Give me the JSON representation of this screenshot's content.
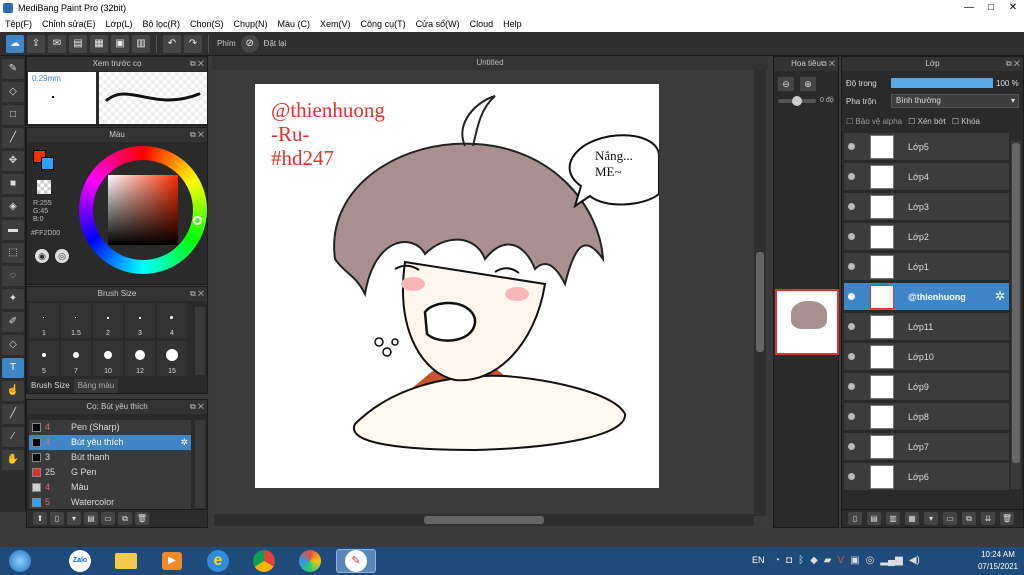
{
  "window": {
    "title": "MediBang Paint Pro (32bit)",
    "min": "—",
    "max": "□",
    "close": "✕"
  },
  "menu": [
    "Tệp(F)",
    "Chỉnh sửa(E)",
    "Lớp(L)",
    "Bộ lọc(R)",
    "Chọn(S)",
    "Chụp(N)",
    "Màu (C)",
    "Xem(V)",
    "Công cụ(T)",
    "Cửa sổ(W)",
    "Cloud",
    "Help"
  ],
  "toolbar": {
    "shortcut_label": "Phím",
    "reset_label": "Đặt lại"
  },
  "preview_panel": {
    "title": "Xem trước cọ",
    "size": "0.29mm"
  },
  "color_panel": {
    "title": "Màu",
    "r": "R:255",
    "g": "G:45",
    "b": "B:0",
    "hex": "#FF2D00",
    "primary": "#ff2d00",
    "secondary": "#2aa4ff"
  },
  "brush_size_panel": {
    "title": "Brush Size",
    "sizes": [
      "1",
      "1.5",
      "2",
      "3",
      "4",
      "5",
      "7",
      "10",
      "12",
      "15"
    ],
    "tab1": "Brush Size",
    "tab2": "Bảng màu"
  },
  "brush_panel": {
    "title": "Cọ: Bút yêu thích",
    "items": [
      {
        "size": "4",
        "name": "Pen (Sharp)",
        "color": "#000000"
      },
      {
        "size": "4",
        "name": "Bút yêu thích",
        "color": "#000000",
        "selected": true
      },
      {
        "size": "3",
        "name": "Bút thanh",
        "color": "#000000"
      },
      {
        "size": "25",
        "name": "G Pen",
        "color": "#e0312b"
      },
      {
        "size": "4",
        "name": "Màu",
        "color": "#cfcfcf"
      },
      {
        "size": "5",
        "name": "Watercolor",
        "color": "#2aa4ff"
      }
    ]
  },
  "canvas": {
    "title": "Untitled",
    "watermark1": "@thienhuong",
    "watermark2": "-Ru-",
    "watermark3": "#hd247",
    "speech": "Nắng...\nME~"
  },
  "navigator": {
    "title": "Hoa tiêu",
    "angle": "0 độ"
  },
  "layers_panel": {
    "title": "Lớp",
    "opacity_label": "Độ trong",
    "opacity_value": "100 %",
    "opacity": 1.0,
    "blend_label": "Pha trộn",
    "blend_value": "Bình thường",
    "protect_alpha": "Bảo vệ alpha",
    "clipping": "Xén bớt",
    "lock": "Khóa",
    "layers": [
      {
        "name": "Lớp5"
      },
      {
        "name": "Lớp4"
      },
      {
        "name": "Lớp3"
      },
      {
        "name": "Lớp2"
      },
      {
        "name": "Lớp1"
      },
      {
        "name": "@thienhuong",
        "selected": true
      },
      {
        "name": "Lớp11"
      },
      {
        "name": "Lớp10"
      },
      {
        "name": "Lớp9"
      },
      {
        "name": "Lớp8"
      },
      {
        "name": "Lớp7"
      },
      {
        "name": "Lớp6"
      }
    ]
  },
  "taskbar": {
    "lang": "EN",
    "time": "10:24 AM",
    "date": "07/15/2021",
    "zalo": "Zalo"
  }
}
